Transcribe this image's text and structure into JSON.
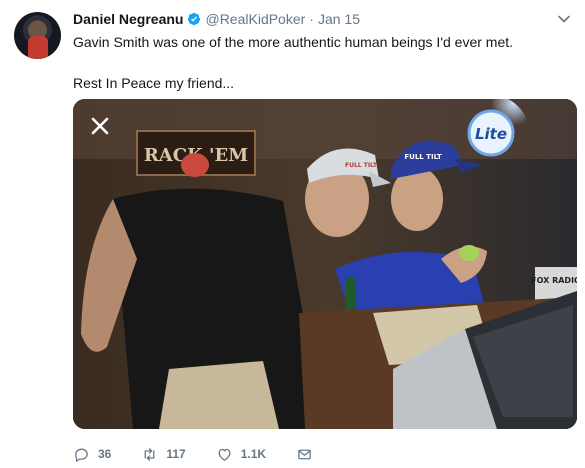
{
  "tweet": {
    "author_name": "Daniel Negreanu",
    "handle": "@RealKidPoker",
    "separator": "·",
    "time": "Jan 15",
    "line1": "Gavin Smith was one of the more authentic human beings I'd ever met.",
    "line2": "Rest In Peace my friend...",
    "verified": true,
    "accent_color": "#1da1f2"
  },
  "media": {
    "bar_sign_text": "RACK 'EM",
    "cap_logo_text": "FULL TILT",
    "beer_sign_text": "Lite",
    "radio_sign_text": "FOX RADIO",
    "close_icon": "close-icon"
  },
  "actions": {
    "reply_count": "36",
    "retweet_count": "117",
    "like_count": "1.1K",
    "icons": [
      "reply-icon",
      "retweet-icon",
      "like-icon",
      "direct-message-icon"
    ]
  }
}
